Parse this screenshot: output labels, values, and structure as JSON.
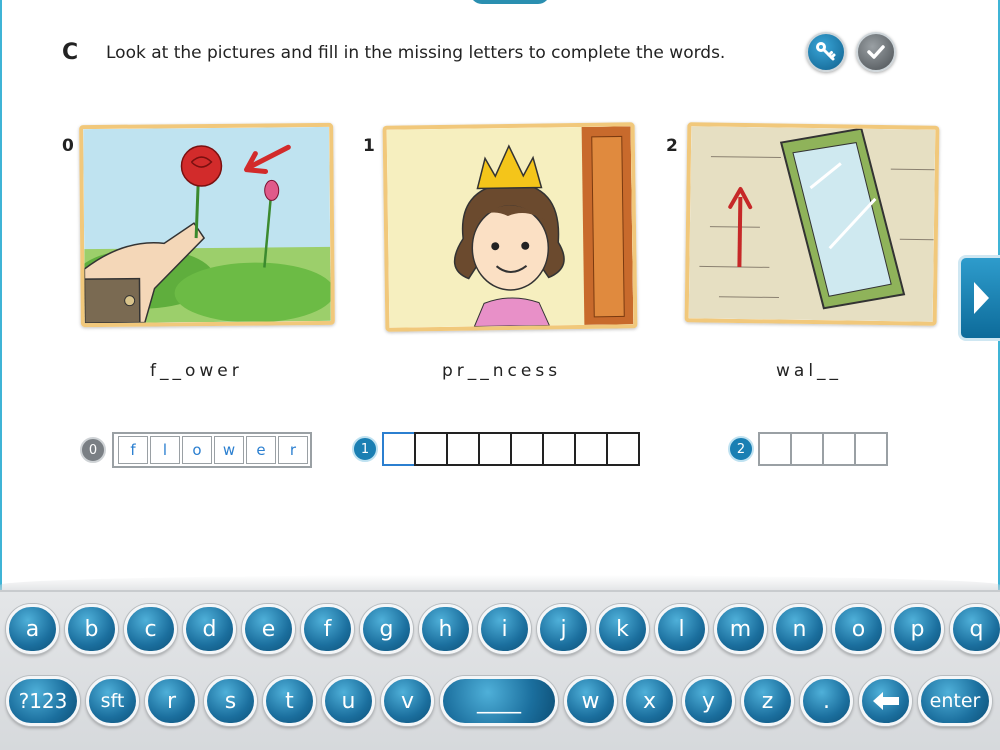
{
  "section": {
    "letter": "C",
    "instruction": "Look at the pictures and fill in the missing letters to complete the words."
  },
  "toolbar": {
    "key_icon": "key-icon",
    "check_icon": "check-icon"
  },
  "items": [
    {
      "num": "0",
      "word": "f__ower",
      "answer": [
        "f",
        "l",
        "o",
        "w",
        "e",
        "r"
      ]
    },
    {
      "num": "1",
      "word": "pr__ncess",
      "answer": [
        "",
        "",
        "",
        "",
        "",
        "",
        "",
        ""
      ]
    },
    {
      "num": "2",
      "word": "wal__",
      "answer": [
        "",
        "",
        "",
        ""
      ]
    }
  ],
  "answer_labels": {
    "b0": "0",
    "b1": "1",
    "b2": "2"
  },
  "navigation": {
    "next_icon": "chevron-right-icon"
  },
  "keyboard": {
    "row1": [
      "a",
      "b",
      "c",
      "d",
      "e",
      "f",
      "g",
      "h",
      "i",
      "j",
      "k",
      "l",
      "m",
      "n",
      "o",
      "p",
      "q"
    ],
    "row2": [
      "?123",
      "sft",
      "r",
      "s",
      "t",
      "u",
      "v",
      "____",
      "w",
      "x",
      "y",
      "z",
      ".",
      "",
      "enter"
    ]
  },
  "colors": {
    "accent": "#1a7fb3",
    "frame": "#f1c87b"
  }
}
